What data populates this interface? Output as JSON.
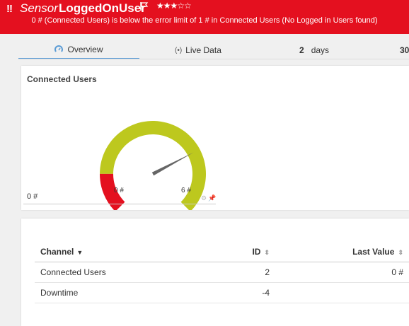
{
  "header": {
    "alert_marker": "!!",
    "sensor_type": "Sensor",
    "sensor_name": "LoggedOnUser",
    "flag_icon": "flag-icon",
    "priority_stars": "★★★☆☆",
    "priority_value": 3,
    "priority_max": 5,
    "message": "0 # (Connected Users) is below the error limit of 1 # in Connected Users (No Logged in Users found)",
    "bg_color": "#e4101f"
  },
  "tabs": {
    "overview": "Overview",
    "live_data": "Live Data",
    "days_number": "2",
    "days_label": "days",
    "thirty": "30"
  },
  "gauge": {
    "title": "Connected Users",
    "current_display": "0 #",
    "min_label": "0 #",
    "max_label": "6 #",
    "needle_value_fraction": 0.73,
    "error_zone_fraction": 0.167,
    "colors": {
      "ok": "#bdc81e",
      "error": "#e4101f",
      "needle": "#666666"
    }
  },
  "table": {
    "headers": {
      "channel": "Channel",
      "id": "ID",
      "last_value": "Last Value"
    },
    "rows": [
      {
        "channel": "Connected Users",
        "id": "2",
        "last_value": "0 #"
      },
      {
        "channel": "Downtime",
        "id": "-4",
        "last_value": ""
      }
    ]
  }
}
